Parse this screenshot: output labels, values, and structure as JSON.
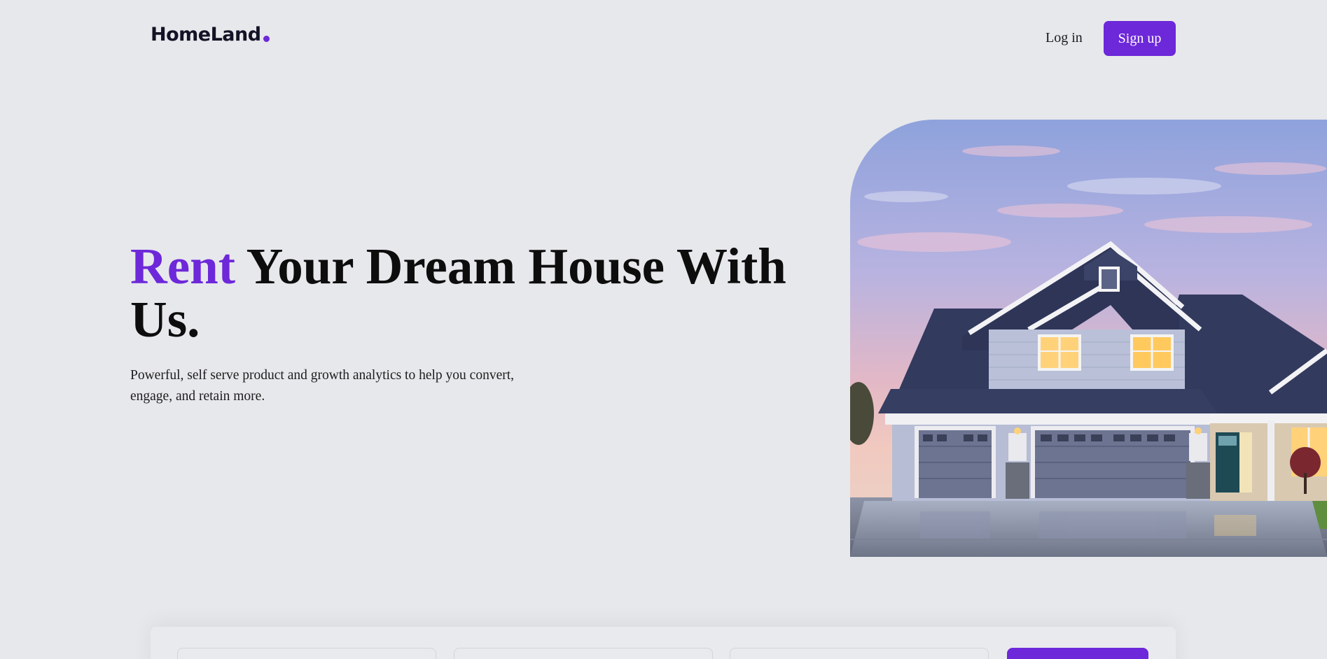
{
  "brand": {
    "name": "HomeLand",
    "accent_color": "#6d28d9"
  },
  "nav": {
    "login_label": "Log in",
    "signup_label": "Sign up"
  },
  "hero": {
    "title_accent": "Rent",
    "title_rest": " Your Dream House With Us.",
    "description": "Powerful, self serve product and growth analytics to help you convert, engage, and retain more."
  },
  "hero_image": {
    "subject": "two-story house with garages at dusk"
  },
  "search": {
    "fields": [
      "",
      "",
      ""
    ],
    "button_label": ""
  }
}
